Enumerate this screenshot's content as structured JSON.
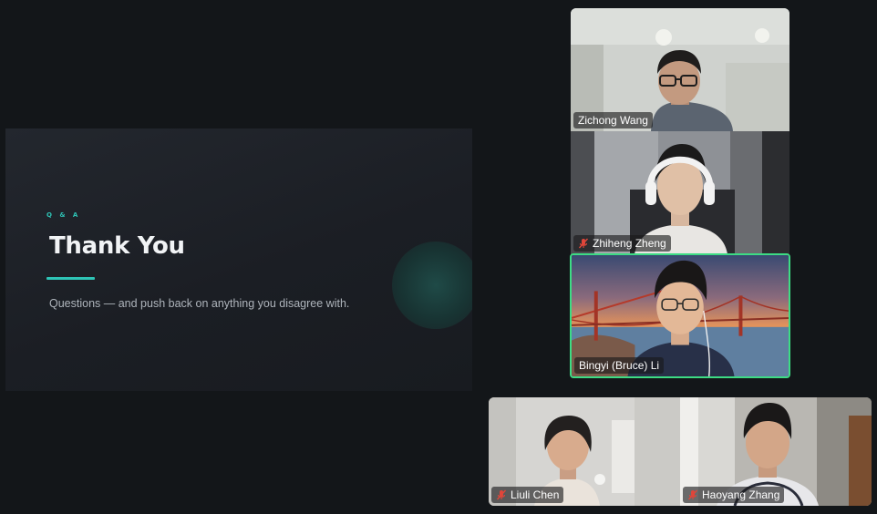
{
  "slide": {
    "eyebrow": "Q & A",
    "title": "Thank You",
    "subtitle": "Questions — and push back on anything you disagree with.",
    "accent_color": "#2ec4b6"
  },
  "participants": [
    {
      "name": "Zichong Wang",
      "muted": false,
      "active": false
    },
    {
      "name": "Zhiheng Zheng",
      "muted": true,
      "active": false
    },
    {
      "name": "Bingyi (Bruce) Li",
      "muted": false,
      "active": true
    },
    {
      "name": "Liuli Chen",
      "muted": true,
      "active": false
    },
    {
      "name": "Haoyang Zhang",
      "muted": true,
      "active": false
    }
  ],
  "colors": {
    "background": "#131619",
    "active_speaker_border": "#3ddc84",
    "muted_mic": "#e0463a"
  },
  "icons": {
    "muted_mic": "mic-muted-icon"
  }
}
